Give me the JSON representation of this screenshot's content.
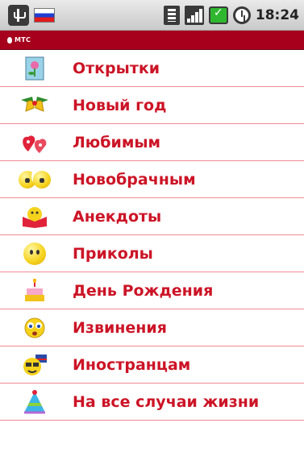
{
  "statusbar": {
    "time": "18:24",
    "icons": [
      "usb-icon",
      "flag-icon",
      "sim-icon",
      "signal-icon",
      "battery-icon",
      "alarm-icon"
    ]
  },
  "carrier": {
    "name": "МТС"
  },
  "menu": {
    "items": [
      {
        "label": "Открытки",
        "icon": "postcard-icon"
      },
      {
        "label": "Новый год",
        "icon": "christmas-bells-icon"
      },
      {
        "label": "Любимым",
        "icon": "hearts-icon"
      },
      {
        "label": "Новобрачным",
        "icon": "newlyweds-icon"
      },
      {
        "label": "Анекдоты",
        "icon": "reading-smiley-icon"
      },
      {
        "label": "Приколы",
        "icon": "smiley-icon"
      },
      {
        "label": "День Рождения",
        "icon": "birthday-cake-icon"
      },
      {
        "label": "Извинения",
        "icon": "sorry-smiley-icon"
      },
      {
        "label": "Иностранцам",
        "icon": "foreigner-smiley-icon"
      },
      {
        "label": "На все случаи жизни",
        "icon": "party-hat-icon"
      }
    ]
  },
  "colors": {
    "accent": "#cc1426",
    "carrier_bar": "#a6001c",
    "divider": "#f08a96"
  }
}
